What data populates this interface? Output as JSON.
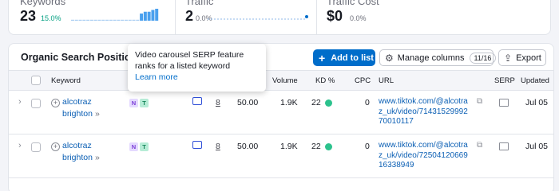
{
  "summary": {
    "keywords": {
      "label": "Keywords",
      "value": "23",
      "change": "15.0%",
      "change_color": "#009f81",
      "bar_heights": [
        0.08,
        0.08,
        0.08,
        0.08,
        0.08,
        0.08,
        0.08,
        0.08,
        0.08,
        0.08,
        0.08,
        0.08,
        0.08,
        0.08,
        0.08,
        0.08,
        0.08,
        0.08,
        0.6,
        0.75,
        0.75,
        0.9,
        1.0
      ]
    },
    "traffic": {
      "label": "Traffic",
      "value": "2",
      "change": "0.0%"
    },
    "traffic_cost": {
      "label": "Traffic Cost",
      "value": "$0",
      "change": "0.0%"
    }
  },
  "panel": {
    "title": "Organic Search Positions",
    "add_to_list": "Add to list",
    "manage_columns": "Manage columns",
    "columns_count": "11/16",
    "export": "Export"
  },
  "table": {
    "headers": {
      "keyword": "Keyword",
      "volume": "Volume",
      "kd": "KD %",
      "cpc": "CPC",
      "url": "URL",
      "serp": "SERP",
      "updated": "Updated"
    },
    "rows": [
      {
        "keyword_line1": "alcotraz",
        "keyword_line2": "brighton",
        "intent1": "N",
        "intent2": "T",
        "position": "8",
        "traffic_share": "50.00",
        "volume": "1.9K",
        "kd": "22",
        "kd_color": "#2cc28d",
        "cpc": "0",
        "url_line1": "www.tiktok.com/@alcotra",
        "url_line2": "z_uk/video/71431529992",
        "url_line3": "70010117",
        "updated": "Jul 05"
      },
      {
        "keyword_line1": "alcotraz",
        "keyword_line2": "brighton",
        "intent1": "N",
        "intent2": "T",
        "position": "8",
        "traffic_share": "50.00",
        "volume": "1.9K",
        "kd": "22",
        "kd_color": "#2cc28d",
        "cpc": "0",
        "url_line1": "www.tiktok.com/@alcotra",
        "url_line2": "z_uk/video/72504120669",
        "url_line3": "16338949",
        "updated": "Jul 05"
      }
    ]
  },
  "tooltip": {
    "text_line1": "Video carousel SERP feature",
    "text_line2": "ranks for a listed keyword",
    "link": "Learn more"
  },
  "icons": [
    "plus-icon",
    "gear-icon",
    "export-icon",
    "chevron-right-icon",
    "add-circle-icon",
    "video-carousel-icon",
    "external-link-icon",
    "serp-snapshot-icon",
    "double-chevron-icon"
  ],
  "colors": {
    "accent": "#006dca",
    "link": "#0b5fb4",
    "kd_easy": "#2cc28d",
    "intent_n_bg": "#e4d9ff",
    "intent_t_bg": "#b6ecd6"
  }
}
